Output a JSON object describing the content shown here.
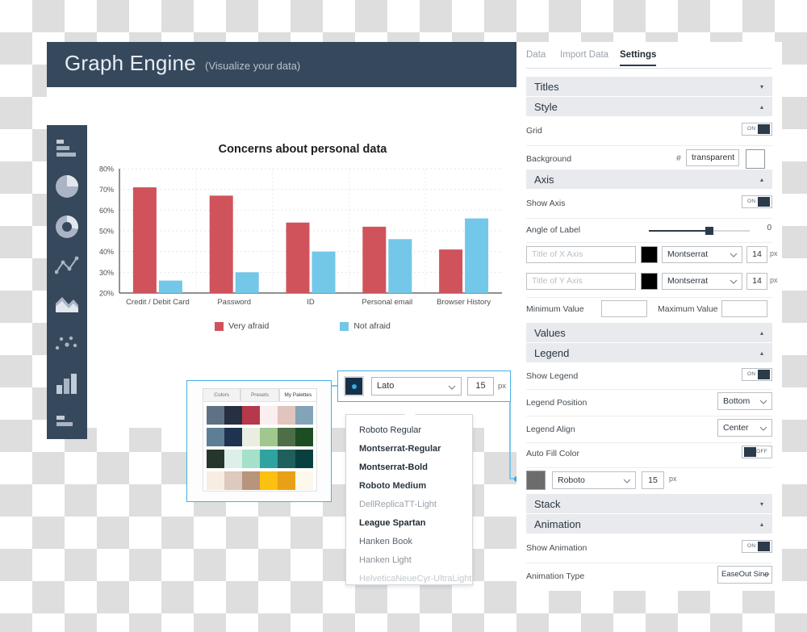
{
  "app": {
    "title": "Graph Engine",
    "subtitle": "(Visualize your data)",
    "logo_icon": "bar-chart-icon"
  },
  "tool_rail": [
    {
      "name": "horizontal-bar-chart-icon"
    },
    {
      "name": "pie-chart-icon"
    },
    {
      "name": "donut-chart-icon"
    },
    {
      "name": "line-chart-icon"
    },
    {
      "name": "area-chart-icon"
    },
    {
      "name": "scatter-chart-icon"
    },
    {
      "name": "column-chart-icon"
    },
    {
      "name": "horizontal-bar-chart-icon-2"
    }
  ],
  "chart_data": {
    "type": "bar",
    "title": "Concerns about personal data",
    "categories": [
      "Credit / Debit Card",
      "Password",
      "ID",
      "Personal email",
      "Browser History"
    ],
    "series": [
      {
        "name": "Very afraid",
        "color": "#d0535c",
        "values": [
          71,
          67,
          54,
          52,
          41
        ]
      },
      {
        "name": "Not afraid",
        "color": "#73c7e8",
        "values": [
          26,
          30,
          40,
          46,
          56
        ]
      }
    ],
    "ylabel": "",
    "xlabel": "",
    "ylim": [
      20,
      80
    ],
    "yticks": [
      "20%",
      "30%",
      "40%",
      "50%",
      "60%",
      "70%",
      "80%"
    ],
    "grid": true,
    "legend_position": "bottom",
    "legend_align": "center"
  },
  "palette_popup": {
    "tabs": [
      {
        "label": "Colors",
        "active": false
      },
      {
        "label": "Presets",
        "active": false
      },
      {
        "label": "My Palettes",
        "active": true
      }
    ],
    "rows": [
      [
        "#5f7285",
        "#273043",
        "#b5384b",
        "#fbeeee",
        "#e0c4bd",
        "#82a3b8"
      ],
      [
        "#5e7e96",
        "#1f3350",
        "#e9eee0",
        "#9fc78e",
        "#4d6e46",
        "#1d4d23"
      ],
      [
        "#25372a",
        "#dcefe9",
        "#a5e0ca",
        "#2fa3a0",
        "#1f5f5e",
        "#08403f"
      ],
      [
        "#f7ede3",
        "#ddc9bd",
        "#b8947c",
        "#fcc010",
        "#e8a117",
        "#fdf8ec"
      ]
    ]
  },
  "font_bar": {
    "color_chip": "#17304a",
    "font": "Lato",
    "size": "15",
    "unit": "px"
  },
  "font_list": [
    {
      "label": "Roboto Regular",
      "weight": "normal",
      "color": "#2b3642"
    },
    {
      "label": "Montserrat-Regular",
      "weight": "bold",
      "color": "#2b3642"
    },
    {
      "label": "Montserrat-Bold",
      "weight": "bold",
      "color": "#1f2933"
    },
    {
      "label": "Roboto Medium",
      "weight": "bold",
      "color": "#2b3642"
    },
    {
      "label": "DellReplicaTT-Light",
      "weight": "normal",
      "color": "#9aa1a9"
    },
    {
      "label": "League Spartan",
      "weight": "bold",
      "color": "#1f2933"
    },
    {
      "label": "Hanken Book",
      "weight": "normal",
      "color": "#5a636c"
    },
    {
      "label": "Hanken Light",
      "weight": "normal",
      "color": "#8a9299"
    },
    {
      "label": "HelveticaNeueCyr-UltraLight",
      "weight": "normal",
      "color": "#c3c8cd"
    }
  ],
  "settings": {
    "tabs": [
      {
        "label": "Data",
        "active": false
      },
      {
        "label": "Import Data",
        "active": false
      },
      {
        "label": "Settings",
        "active": true
      }
    ],
    "sections": {
      "titles": {
        "label": "Titles",
        "state": "collapsed",
        "chevron": "▾"
      },
      "style": {
        "label": "Style",
        "state": "expanded",
        "chevron": "▴"
      },
      "axis": {
        "label": "Axis",
        "state": "expanded",
        "chevron": "▴"
      },
      "values": {
        "label": "Values",
        "state": "expanded",
        "chevron": "▴"
      },
      "legend": {
        "label": "Legend",
        "state": "expanded",
        "chevron": "▴"
      },
      "stack": {
        "label": "Stack",
        "state": "collapsed",
        "chevron": "▾"
      },
      "animation": {
        "label": "Animation",
        "state": "expanded",
        "chevron": "▴"
      }
    },
    "grid": {
      "label": "Grid",
      "toggle": "ON"
    },
    "background": {
      "label": "Background",
      "hash": "#",
      "value": "transparent",
      "swatch": "#ffffff"
    },
    "show_axis": {
      "label": "Show Axis",
      "toggle": "ON"
    },
    "angle_of_label": {
      "label": "Angle of Label",
      "value": "0"
    },
    "x_axis": {
      "placeholder": "Title of X Axis",
      "swatch": "#000000",
      "font": "Montserrat",
      "size": "14",
      "unit": "px"
    },
    "y_axis": {
      "placeholder": "Title of Y Axis",
      "swatch": "#000000",
      "font": "Montserrat",
      "size": "14",
      "unit": "px"
    },
    "minimum_value": {
      "label": "Minimum Value",
      "value": ""
    },
    "maximum_value": {
      "label": "Maximum Value",
      "value": ""
    },
    "show_legend": {
      "label": "Show Legend",
      "toggle": "ON"
    },
    "legend_position": {
      "label": "Legend Position",
      "value": "Bottom"
    },
    "legend_align": {
      "label": "Legend Align",
      "value": "Center"
    },
    "auto_fill_color": {
      "label": "Auto Fill Color",
      "toggle": "OFF"
    },
    "legend_font": {
      "swatch": "#6c6c6c",
      "font": "Roboto",
      "size": "15",
      "unit": "px"
    },
    "show_animation": {
      "label": "Show Animation",
      "toggle": "ON"
    },
    "animation_type": {
      "label": "Animation Type",
      "value": "EaseOut Sine"
    }
  }
}
